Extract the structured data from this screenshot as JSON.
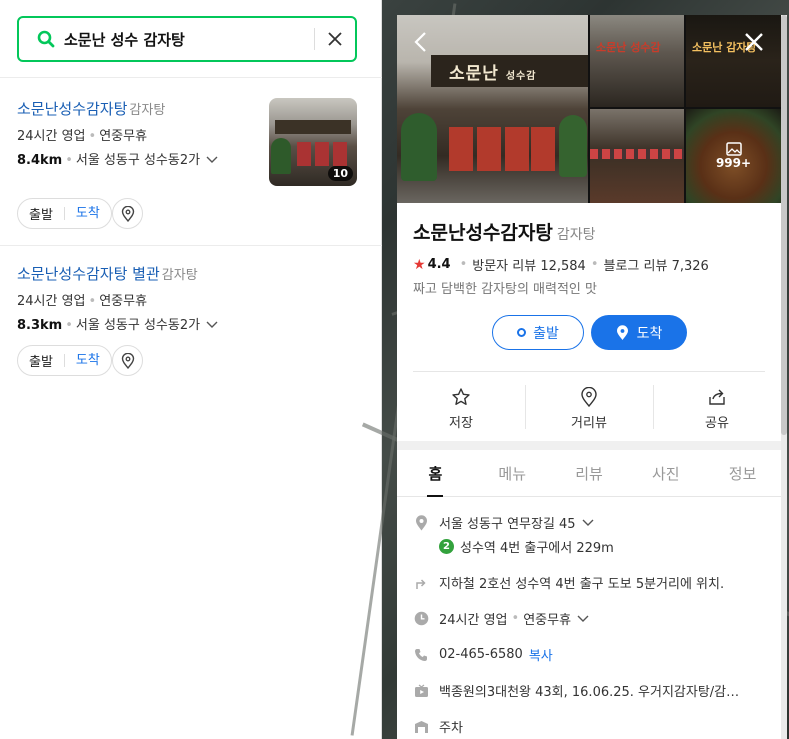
{
  "search": {
    "query": "소문난 성수 감자탕"
  },
  "results": [
    {
      "name": "소문난성수감자탕",
      "category": "감자탕",
      "hours": "24시간 영업",
      "holiday": "연중무휴",
      "distance": "8.4km",
      "address": "서울 성동구 성수동2가",
      "photo_count": "10",
      "depart_label": "출발",
      "arrive_label": "도착"
    },
    {
      "name": "소문난성수감자탕 별관",
      "category": "감자탕",
      "hours": "24시간 영업",
      "holiday": "연중무휴",
      "distance": "8.3km",
      "address": "서울 성동구 성수동2가",
      "depart_label": "출발",
      "arrive_label": "도착"
    }
  ],
  "detail": {
    "sign_text": "소문난",
    "sign_small": "성수감",
    "thumb_sign_b": "소문난 성수감",
    "thumb_sign_c": "소문난 감자탕",
    "photo_more": "999+",
    "name": "소문난성수감자탕",
    "category": "감자탕",
    "rating": "4.4",
    "visitor_reviews": "방문자 리뷰 12,584",
    "blog_reviews": "블로그 리뷰 7,326",
    "description": "짜고 담백한 감자탕의 매력적인 맛",
    "depart_label": "출발",
    "arrive_label": "도착",
    "actions": {
      "save": "저장",
      "street": "거리뷰",
      "share": "공유"
    },
    "tabs": [
      "홈",
      "메뉴",
      "리뷰",
      "사진",
      "정보"
    ],
    "address": "서울 성동구 연무장길 45",
    "subway_line": "2",
    "subway_text": "성수역 4번 출구에서 229m",
    "directions": "지하철 2호선 성수역 4번 출구 도보 5분거리에 위치.",
    "hours": "24시간 영업",
    "holiday": "연중무휴",
    "phone": "02-465-6580",
    "copy_label": "복사",
    "tv": "백종원의3대천왕 43회, 16.06.25. 우거지감자탕/감…",
    "parking": "주차"
  },
  "colors": {
    "search_border": "#03c75a",
    "link_blue": "#1a5fb4",
    "accent_blue": "#1a73e8",
    "star_red": "#e53935",
    "subway_green": "#33a23d"
  }
}
